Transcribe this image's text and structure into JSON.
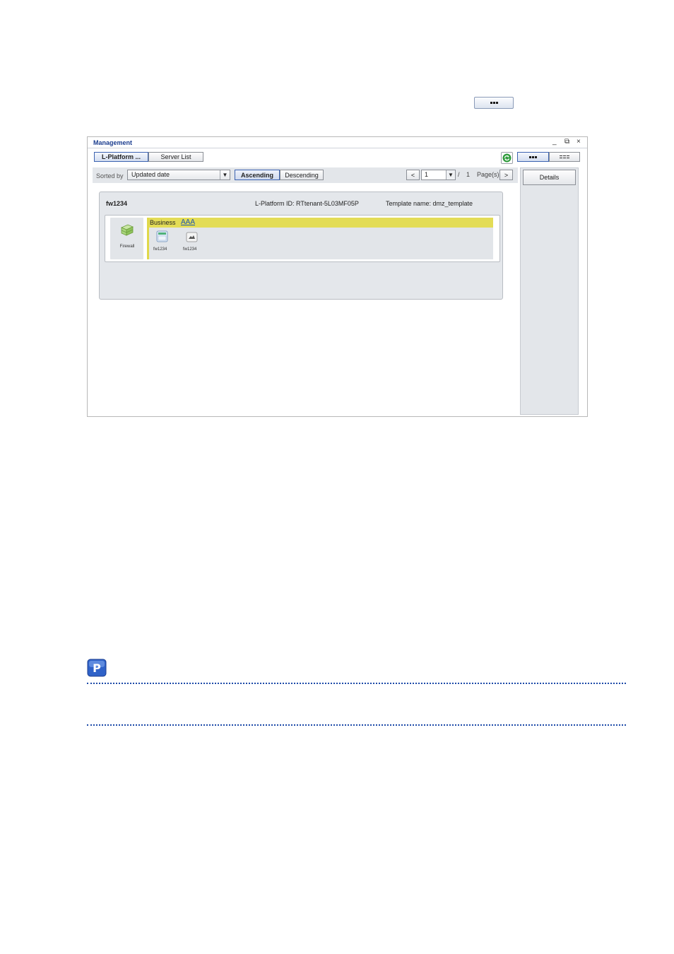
{
  "window": {
    "title": "Management",
    "controls": {
      "minimize": "_",
      "restore": "⧉",
      "close": "×"
    },
    "tabs": [
      {
        "label": "L-Platform ...",
        "selected": true
      },
      {
        "label": "Server List",
        "selected": false
      }
    ]
  },
  "toolbar": {
    "sorted_by_label": "Sorted by",
    "sort_field": "Updated date",
    "ascending_label": "Ascending",
    "descending_label": "Descending",
    "page_prev": "<",
    "page_current": "1",
    "page_separator": "/",
    "page_total": "1",
    "page_suffix": "Page(s)",
    "page_next": ">"
  },
  "details": {
    "button_label": "Details"
  },
  "lplatform": {
    "name": "fw1234",
    "id_text": "L-Platform ID: RTtenant-5L03MF05P",
    "template_text": "Template name: dmz_template",
    "firewall_label": "Firewall",
    "segment": {
      "type_label": "Business",
      "name": "AAA"
    },
    "servers": [
      {
        "name": "fw1234",
        "icon": "server-icon"
      },
      {
        "name": "fw1234",
        "icon": "disk-image-icon"
      }
    ]
  },
  "colors": {
    "accent": "#3c63b0",
    "segment_bar": "#e3dc56",
    "link": "#1c55b0",
    "title": "#1b3d8f"
  }
}
